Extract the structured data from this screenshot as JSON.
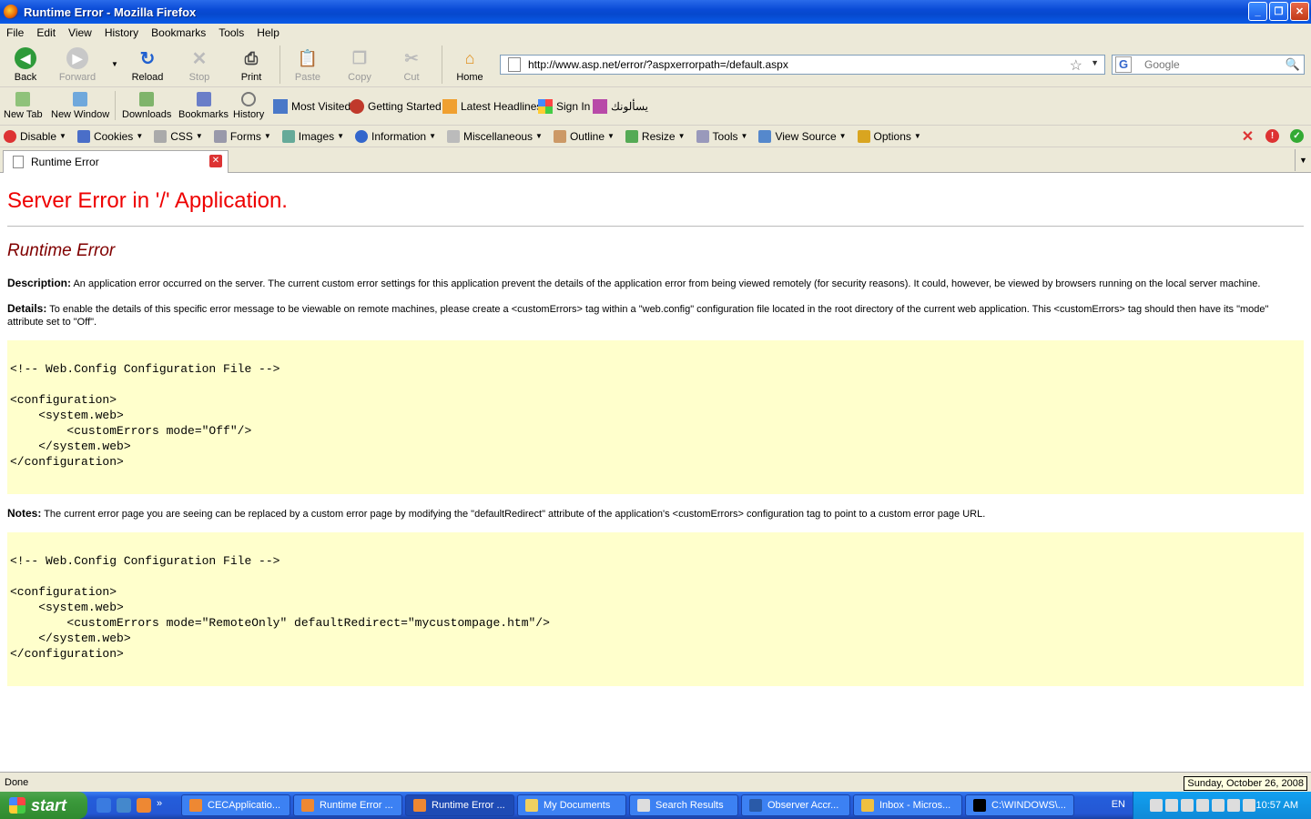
{
  "window": {
    "title": "Runtime Error - Mozilla Firefox"
  },
  "menu": [
    "File",
    "Edit",
    "View",
    "History",
    "Bookmarks",
    "Tools",
    "Help"
  ],
  "nav": {
    "back": "Back",
    "forward": "Forward",
    "reload": "Reload",
    "stop": "Stop",
    "print": "Print",
    "paste": "Paste",
    "copy": "Copy",
    "cut": "Cut",
    "home": "Home"
  },
  "url": "http://www.asp.net/error/?aspxerrorpath=/default.aspx",
  "search": {
    "placeholder": "Google"
  },
  "bookbar": {
    "new_tab": "New Tab",
    "new_window": "New Window",
    "downloads": "Downloads",
    "bookmarks": "Bookmarks",
    "history": "History",
    "links": [
      "Most Visited",
      "Getting Started",
      "Latest Headlines",
      "Sign In",
      "يسألونك"
    ]
  },
  "devbar": [
    "Disable",
    "Cookies",
    "CSS",
    "Forms",
    "Images",
    "Information",
    "Miscellaneous",
    "Outline",
    "Resize",
    "Tools",
    "View Source",
    "Options"
  ],
  "tab": {
    "title": "Runtime Error"
  },
  "page": {
    "heading": "Server Error in '/' Application.",
    "subheading": "Runtime Error",
    "desc_label": "Description:",
    "desc_text": "An application error occurred on the server. The current custom error settings for this application prevent the details of the application error from being viewed remotely (for security reasons). It could, however, be viewed by browsers running on the local server machine.",
    "details_label": "Details:",
    "details_text": "To enable the details of this specific error message to be viewable on remote machines, please create a <customErrors> tag within a \"web.config\" configuration file located in the root directory of the current web application. This <customErrors> tag should then have its \"mode\" attribute set to \"Off\".",
    "code1": "\n<!-- Web.Config Configuration File -->\n\n<configuration>\n    <system.web>\n        <customErrors mode=\"Off\"/>\n    </system.web>\n</configuration>",
    "notes_label": "Notes:",
    "notes_text": "The current error page you are seeing can be replaced by a custom error page by modifying the \"defaultRedirect\" attribute of the application's <customErrors> configuration tag to point to a custom error page URL.",
    "code2": "\n<!-- Web.Config Configuration File -->\n\n<configuration>\n    <system.web>\n        <customErrors mode=\"RemoteOnly\" defaultRedirect=\"mycustompage.htm\"/>\n    </system.web>\n</configuration>"
  },
  "status": {
    "text": "Done",
    "tooltip": "Sunday, October 26, 2008"
  },
  "taskbar": {
    "start": "start",
    "tasks": [
      "CECApplicatio...",
      "Runtime Error ...",
      "Runtime Error ...",
      "My Documents",
      "Search Results",
      "Observer Accr...",
      "Inbox - Micros...",
      "C:\\WINDOWS\\..."
    ],
    "lang": "EN",
    "clock": "10:57 AM"
  }
}
